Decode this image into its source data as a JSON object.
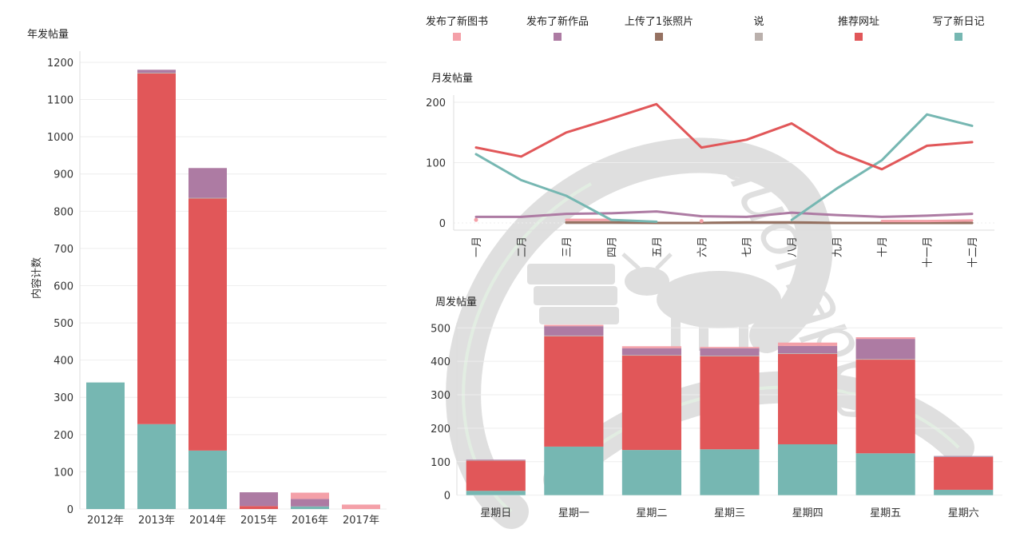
{
  "legend": [
    {
      "name": "发布了新图书",
      "color": "#f4a0a8"
    },
    {
      "name": "发布了新作品",
      "color": "#ad7ba3"
    },
    {
      "name": "上传了1张照片",
      "color": "#957161"
    },
    {
      "name": "说",
      "color": "#bab0ac"
    },
    {
      "name": "推荐网址",
      "color": "#e15759"
    },
    {
      "name": "写了新日记",
      "color": "#76b7b2"
    }
  ],
  "watermark": "duohappy",
  "chart_data": [
    {
      "id": "yearly",
      "type": "bar",
      "stacked": true,
      "title": "年发帖量",
      "ylabel": "内容计数",
      "xlabel": "",
      "ylim": [
        0,
        1230
      ],
      "yticks": [
        0,
        100,
        200,
        300,
        400,
        500,
        600,
        700,
        800,
        900,
        1000,
        1100,
        1200
      ],
      "grid": true,
      "categories": [
        "2012年",
        "2013年",
        "2014年",
        "2015年",
        "2016年",
        "2017年"
      ],
      "series": [
        {
          "name": "写了新日记",
          "color": "#76b7b2",
          "values": [
            340,
            228,
            157,
            0,
            7,
            0
          ]
        },
        {
          "name": "推荐网址",
          "color": "#e15759",
          "values": [
            0,
            942,
            677,
            8,
            0,
            0
          ]
        },
        {
          "name": "说",
          "color": "#bab0ac",
          "values": [
            0,
            2,
            2,
            0,
            0,
            0
          ]
        },
        {
          "name": "上传了1张照片",
          "color": "#957161",
          "values": [
            0,
            0,
            0,
            0,
            0,
            0
          ]
        },
        {
          "name": "发布了新作品",
          "color": "#ad7ba3",
          "values": [
            0,
            8,
            80,
            37,
            20,
            0
          ]
        },
        {
          "name": "发布了新图书",
          "color": "#f4a0a8",
          "values": [
            0,
            0,
            0,
            0,
            17,
            12
          ]
        }
      ]
    },
    {
      "id": "monthly",
      "type": "line",
      "title": "月发帖量",
      "xlabel": "",
      "ylabel": "",
      "ylim": [
        -12,
        212
      ],
      "yticks": [
        0,
        100,
        200
      ],
      "grid": true,
      "categories": [
        "一月",
        "二月",
        "三月",
        "四月",
        "五月",
        "六月",
        "七月",
        "八月",
        "九月",
        "十月",
        "十一月",
        "十二月"
      ],
      "series": [
        {
          "name": "推荐网址",
          "color": "#e15759",
          "values": [
            125,
            110,
            150,
            173,
            197,
            125,
            138,
            165,
            118,
            89,
            128,
            134
          ]
        },
        {
          "name": "写了新日记",
          "color": "#76b7b2",
          "values": [
            114,
            71,
            45,
            5,
            2,
            null,
            null,
            5,
            57,
            104,
            180,
            161
          ]
        },
        {
          "name": "发布了新作品",
          "color": "#ad7ba3",
          "values": [
            10,
            10,
            15,
            16,
            19,
            11,
            10,
            17,
            13,
            10,
            12,
            15
          ]
        },
        {
          "name": "发布了新图书",
          "color": "#f4a0a8",
          "values": [
            5,
            null,
            5,
            5,
            null,
            3,
            null,
            null,
            null,
            3,
            3,
            4
          ]
        },
        {
          "name": "上传了1张照片",
          "color": "#957161",
          "values": [
            null,
            null,
            1,
            1,
            0,
            0,
            1,
            1,
            0,
            0,
            0,
            0
          ]
        },
        {
          "name": "说",
          "color": "#bab0ac",
          "values": [
            null,
            null,
            0,
            0,
            0,
            0,
            0,
            0,
            0,
            0,
            0,
            0
          ]
        }
      ]
    },
    {
      "id": "weekly",
      "type": "bar",
      "stacked": true,
      "title": "周发帖量",
      "xlabel": "",
      "ylabel": "",
      "ylim": [
        -20,
        515
      ],
      "yticks": [
        0,
        100,
        200,
        300,
        400,
        500
      ],
      "grid": true,
      "categories": [
        "星期日",
        "星期一",
        "星期二",
        "星期三",
        "星期四",
        "星期五",
        "星期六"
      ],
      "series": [
        {
          "name": "写了新日记",
          "color": "#76b7b2",
          "values": [
            13,
            145,
            135,
            137,
            152,
            125,
            16
          ]
        },
        {
          "name": "推荐网址",
          "color": "#e15759",
          "values": [
            90,
            330,
            282,
            278,
            270,
            280,
            98
          ]
        },
        {
          "name": "说",
          "color": "#bab0ac",
          "values": [
            1,
            2,
            2,
            2,
            2,
            2,
            1
          ]
        },
        {
          "name": "上传了1张照片",
          "color": "#957161",
          "values": [
            0,
            0,
            0,
            0,
            0,
            0,
            0
          ]
        },
        {
          "name": "发布了新作品",
          "color": "#ad7ba3",
          "values": [
            2,
            28,
            20,
            22,
            22,
            60,
            2
          ]
        },
        {
          "name": "发布了新图书",
          "color": "#f4a0a8",
          "values": [
            0,
            4,
            6,
            4,
            10,
            5,
            0
          ]
        }
      ]
    }
  ]
}
